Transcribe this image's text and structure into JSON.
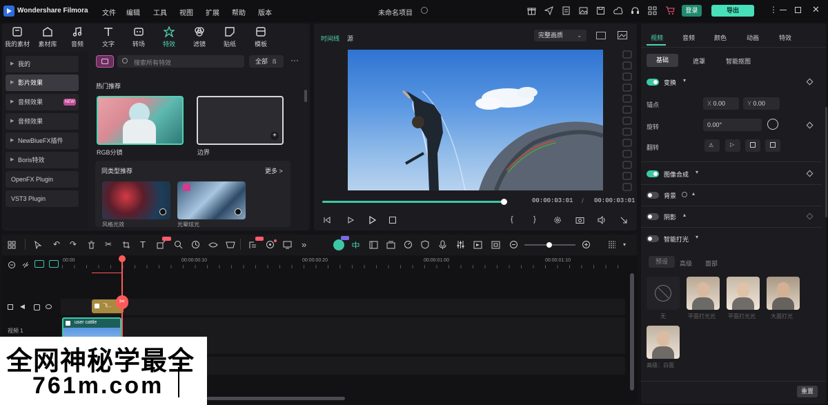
{
  "app": {
    "name": "Wondershare Filmora",
    "project_title": "未命名项目"
  },
  "menu": [
    "文件",
    "编辑",
    "工具",
    "视图",
    "扩展",
    "帮助",
    "版本"
  ],
  "titlebar": {
    "login_label": "登录",
    "export_label": "导出"
  },
  "toolbar_tabs": [
    {
      "label": "我的素材",
      "icon": "media-icon"
    },
    {
      "label": "素材库",
      "icon": "stock-icon"
    },
    {
      "label": "音频",
      "icon": "music-icon"
    },
    {
      "label": "文字",
      "icon": "text-icon"
    },
    {
      "label": "转场",
      "icon": "transition-icon"
    },
    {
      "label": "特效",
      "icon": "effects-icon",
      "active": true
    },
    {
      "label": "滤镜",
      "icon": "filter-icon"
    },
    {
      "label": "贴纸",
      "icon": "sticker-icon"
    },
    {
      "label": "模板",
      "icon": "template-icon"
    }
  ],
  "effects_categories": [
    {
      "label": "我的"
    },
    {
      "label": "影片效果",
      "active": true
    },
    {
      "label": "音频效果",
      "badge": "NEW"
    },
    {
      "label": "音频效果"
    },
    {
      "label": "NewBlueFX插件"
    },
    {
      "label": "Boris特效"
    },
    {
      "label": "OpenFX Plugin"
    },
    {
      "label": "VST3 Plugin"
    }
  ],
  "effects_search": {
    "placeholder": "搜索所有特效",
    "filter_label": "全部",
    "section_title": "热门推荐"
  },
  "effects_cards": [
    {
      "label": "RGB分镜"
    },
    {
      "label": "边界"
    }
  ],
  "recommend": {
    "title": "同类型推荐",
    "more_label": "更多 >",
    "items": [
      {
        "label": "风格光效"
      },
      {
        "label": "光晕炫光"
      }
    ]
  },
  "preview": {
    "tab_timeline": "时间线",
    "tab_source": "源",
    "quality_label": "完整画质",
    "current_time": "00:00:03:01",
    "total_time": "00:00:03:01",
    "progress": 0.99
  },
  "timeline": {
    "ticks": [
      "00:00",
      "00:00:00:10",
      "00:00:00:20",
      "00:00:01:00",
      "00:00:01:10"
    ],
    "track_label": "视频 1",
    "audio_clip_label": "飞...",
    "video_clip_label": "user cattle"
  },
  "properties": {
    "tabs": [
      "视频",
      "音频",
      "颜色",
      "动画",
      "特效"
    ],
    "sub_tabs": [
      "基础",
      "遮罩",
      "智能抠图"
    ],
    "transform": {
      "label": "变换",
      "anchor_label": "锚点",
      "x_value": "0.00",
      "y_value": "0.00",
      "rotate_label": "旋转",
      "rotate_value": "0.00°",
      "flip_label": "翻转"
    },
    "compositing": {
      "label": "图像合成"
    },
    "background": {
      "label": "背景"
    },
    "shadow": {
      "label": "阴影"
    },
    "auto_light": {
      "label": "智能打光",
      "tabs": [
        "预设",
        "高级",
        "面部"
      ]
    },
    "presets": [
      {
        "label": "无"
      },
      {
        "label": "平面打光光"
      },
      {
        "label": "平面打光光"
      },
      {
        "label": "大面打光"
      },
      {
        "label": "高级：白面"
      }
    ],
    "reset_label": "重置"
  },
  "watermark": {
    "line1": "全网神秘学最全",
    "line2": "761m.com"
  },
  "colors": {
    "accent": "#3ec7a6",
    "export": "#47e0b8",
    "login": "#1f8a6e",
    "playhead": "#ff5a5a"
  }
}
